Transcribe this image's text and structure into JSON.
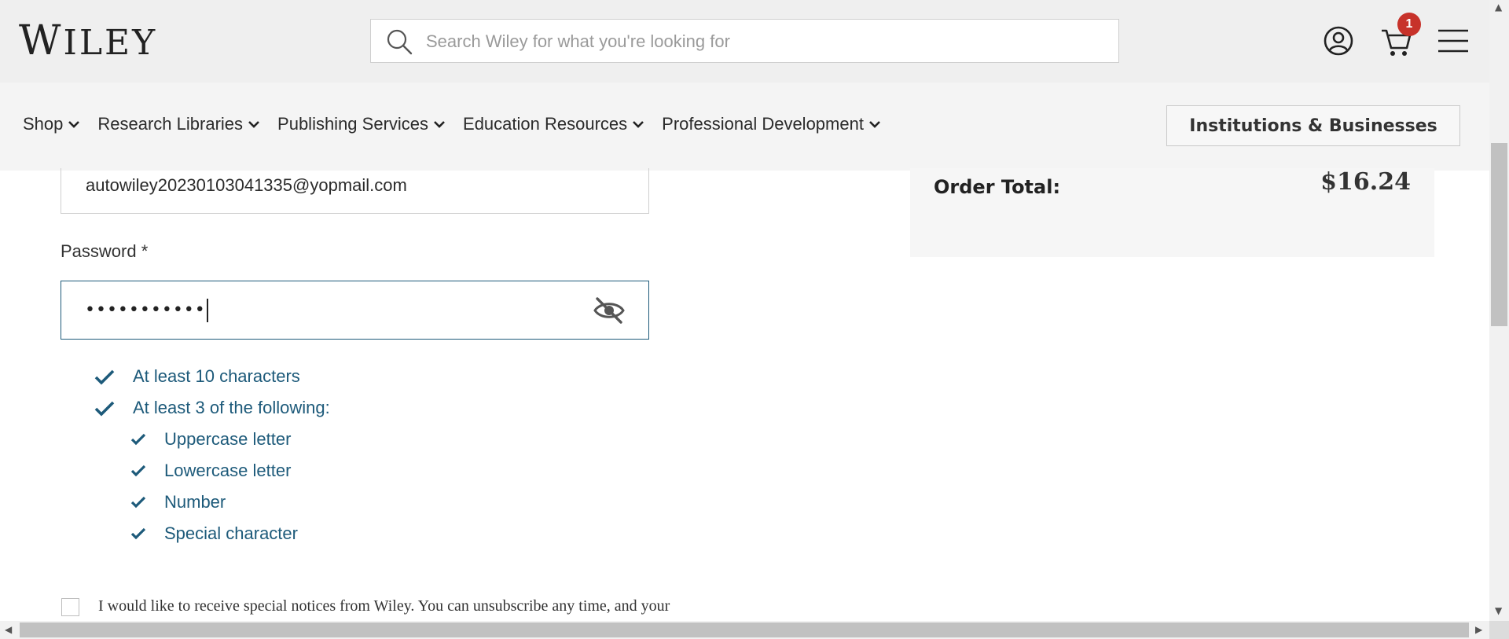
{
  "header": {
    "logo_text": "Wiley",
    "search_placeholder": "Search Wiley for what you're looking for",
    "cart_count": "1",
    "icons": [
      "search-icon",
      "account-icon",
      "cart-icon",
      "menu-icon"
    ]
  },
  "nav": {
    "items": [
      {
        "label": "Shop"
      },
      {
        "label": "Research Libraries"
      },
      {
        "label": "Publishing Services"
      },
      {
        "label": "Education Resources"
      },
      {
        "label": "Professional Development"
      }
    ],
    "institutions_button": "Institutions & Businesses"
  },
  "form": {
    "email_value": "autowiley20230103041335@yopmail.com",
    "password_label": "Password *",
    "password_masked": "•••••••••••",
    "requirements": [
      {
        "label": "At least 10 characters",
        "met": true
      },
      {
        "label": "At least 3 of the following:",
        "met": true
      },
      {
        "label": "Uppercase letter",
        "met": true
      },
      {
        "label": "Lowercase letter",
        "met": true
      },
      {
        "label": "Number",
        "met": true
      },
      {
        "label": "Special character",
        "met": true
      }
    ],
    "consent_text": "I would like to receive special notices from Wiley. You can unsubscribe any time, and your"
  },
  "summary": {
    "order_total_label": "Order Total:",
    "order_total_value": "$16.24"
  },
  "colors": {
    "accent": "#1d5a7a",
    "badge": "#c7322a",
    "header_bg": "#efefef",
    "nav_bg": "#f4f4f4"
  }
}
